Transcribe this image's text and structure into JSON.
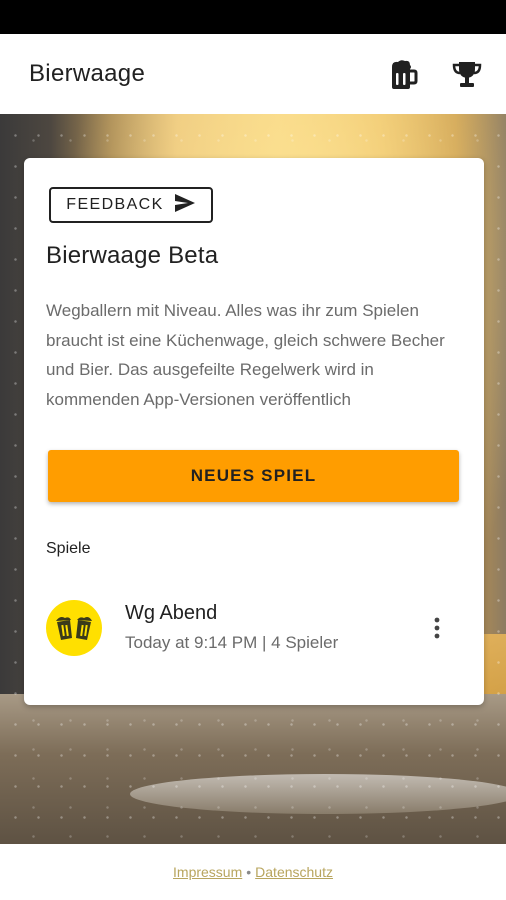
{
  "app_bar": {
    "title": "Bierwaage",
    "beer_icon": "beer-mug-icon",
    "trophy_icon": "trophy-icon"
  },
  "card": {
    "feedback_label": "FEEDBACK",
    "feedback_icon": "send-icon",
    "title": "Bierwaage Beta",
    "description": "Wegballern mit Niveau. Alles was ihr zum Spielen braucht ist eine Küchenwage, gleich schwere Becher und Bier. Das ausgefeilte Regelwerk wird in kommenden App-Versionen veröffentlich",
    "new_game_label": "NEUES SPIEL",
    "section_label": "Spiele",
    "games": [
      {
        "name": "Wg Abend",
        "meta": "Today at 9:14 PM | 4 Spieler",
        "avatar_icon": "beer-cheers-icon",
        "avatar_color": "#ffe000"
      }
    ]
  },
  "footer": {
    "impressum": "Impressum",
    "separator": "•",
    "datenschutz": "Datenschutz"
  },
  "colors": {
    "accent": "#ff9d00",
    "avatar": "#ffe000",
    "link": "#b8a55e"
  }
}
